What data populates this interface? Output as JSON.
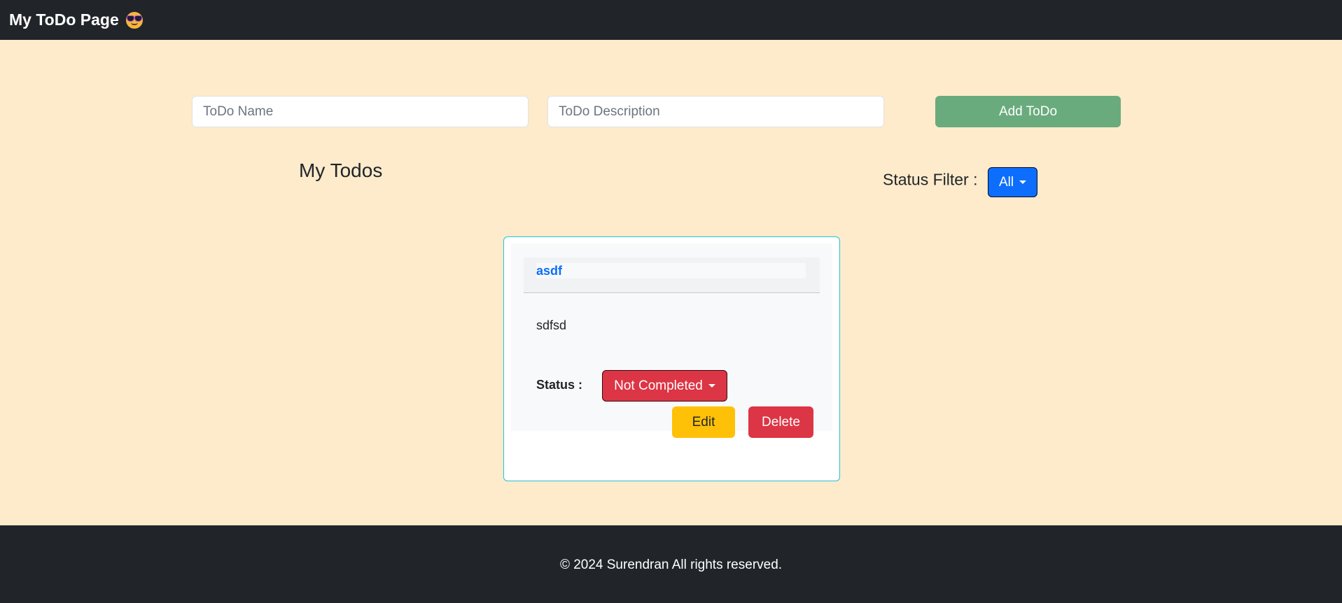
{
  "navbar": {
    "brand": "My ToDo Page",
    "brand_icon": "sunglasses-emoji-icon"
  },
  "form": {
    "name_placeholder": "ToDo Name",
    "description_placeholder": "ToDo Description",
    "add_label": "Add ToDo"
  },
  "list": {
    "title": "My Todos",
    "filter_label": "Status Filter :",
    "filter_value": "All"
  },
  "todos": [
    {
      "title": "asdf",
      "description": "sdfsd",
      "status_label": "Status :",
      "status_value": "Not Completed",
      "edit_label": "Edit",
      "delete_label": "Delete"
    }
  ],
  "footer": {
    "text": "© 2024 Surendran All rights reserved."
  },
  "colors": {
    "page_bg": "#feebcb",
    "nav_bg": "#212529",
    "add_button": "#6aab7d",
    "filter_button": "#0d6efd",
    "status_not_completed": "#dc3545",
    "edit_button": "#ffc107",
    "delete_button": "#dc3545",
    "card_border": "#22c3d8"
  }
}
